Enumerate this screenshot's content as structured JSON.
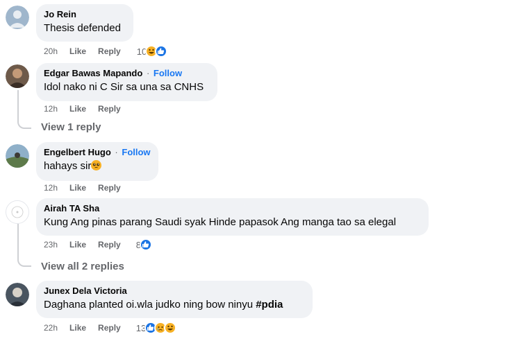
{
  "comments": [
    {
      "author": "Jo Rein",
      "follow": "",
      "text": "Thesis defended",
      "time": "20h",
      "like": "Like",
      "reply": "Reply",
      "reaction_count": "10",
      "reactions": [
        "haha-icon",
        "like-icon"
      ]
    },
    {
      "author": "Edgar Bawas Mapando",
      "follow": "Follow",
      "text": "Idol nako ni C Sir sa una sa CNHS",
      "time": "12h",
      "like": "Like",
      "reply": "Reply",
      "view_replies": "View 1 reply"
    },
    {
      "author": "Engelbert Hugo",
      "follow": "Follow",
      "text": "hahays sir",
      "text_emoji": "pleading-face-icon",
      "time": "12h",
      "like": "Like",
      "reply": "Reply"
    },
    {
      "author": "Airah TA Sha",
      "follow": "",
      "text": "Kung Ang pinas parang Saudi syak Hinde papasok Ang manga tao sa elegal",
      "time": "23h",
      "like": "Like",
      "reply": "Reply",
      "reaction_count": "8",
      "reactions": [
        "like-icon"
      ],
      "view_replies": "View all 2 replies"
    },
    {
      "author": "Junex Dela Victoria",
      "follow": "",
      "text": "Daghana planted oi.wla judko ning bow ninyu ",
      "hashtag": "#pdia",
      "time": "22h",
      "like": "Like",
      "reply": "Reply",
      "reaction_count": "13",
      "reactions": [
        "like-icon",
        "sad-icon",
        "haha-icon"
      ]
    }
  ],
  "separator": "·",
  "colors": {
    "bubble": "#f0f2f5",
    "follow": "#1877f2",
    "meta": "#65676b",
    "like_reaction": "#1b74e4",
    "emoji": "#f7b125"
  }
}
